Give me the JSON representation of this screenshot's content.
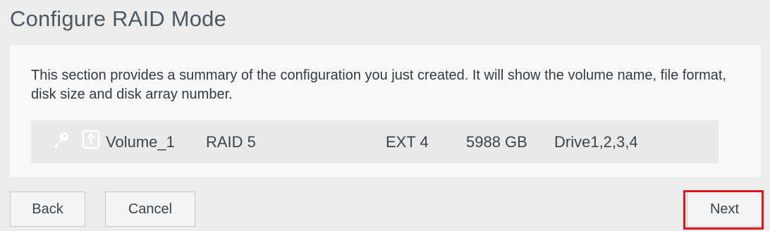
{
  "page": {
    "title": "Configure RAID Mode"
  },
  "summary": {
    "description": "This section provides a summary of the configuration you just created. It will show the volume name, file format, disk size and disk array number.",
    "volume": {
      "icons": [
        "key-icon",
        "upload-icon"
      ],
      "name": "Volume_1",
      "raid_mode": "RAID 5",
      "file_format": "EXT 4",
      "size": "5988 GB",
      "drives": "Drive1,2,3,4"
    }
  },
  "buttons": {
    "back_label": "Back",
    "cancel_label": "Cancel",
    "next_label": "Next"
  },
  "colors": {
    "highlight": "#e0141e",
    "title": "#4d5760"
  }
}
